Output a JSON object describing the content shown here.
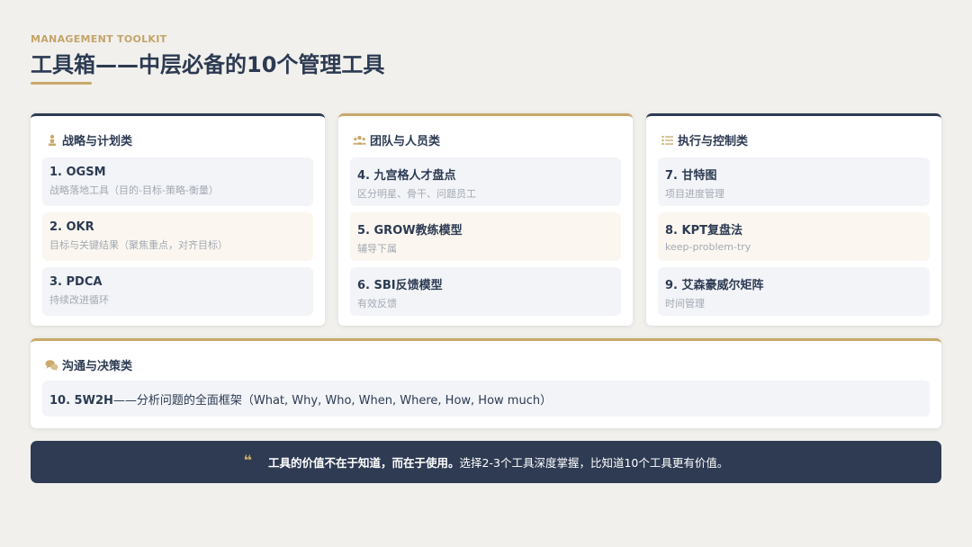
{
  "header": {
    "eyebrow": "MANAGEMENT TOOLKIT",
    "title": "工具箱——中层必备的10个管理工具"
  },
  "categories": [
    {
      "heading": "战略与计划类",
      "icon": "chess-icon",
      "items": [
        {
          "title": "1. OGSM",
          "subtitle": "战略落地工具（目的-目标-策略-衡量）"
        },
        {
          "title": "2. OKR",
          "subtitle": "目标与关键结果（聚焦重点，对齐目标）"
        },
        {
          "title": "3. PDCA",
          "subtitle": "持续改进循环"
        }
      ]
    },
    {
      "heading": "团队与人员类",
      "icon": "team-icon",
      "items": [
        {
          "title": "4. 九宫格人才盘点",
          "subtitle": "区分明星、骨干、问题员工"
        },
        {
          "title": "5. GROW教练模型",
          "subtitle": "辅导下属"
        },
        {
          "title": "6. SBI反馈模型",
          "subtitle": "有效反馈"
        }
      ]
    },
    {
      "heading": "执行与控制类",
      "icon": "list-icon",
      "items": [
        {
          "title": "7. 甘特图",
          "subtitle": "项目进度管理"
        },
        {
          "title": "8. KPT复盘法",
          "subtitle": "keep-problem-try"
        },
        {
          "title": "9. 艾森豪威尔矩阵",
          "subtitle": "时间管理"
        }
      ]
    }
  ],
  "communication": {
    "heading": "沟通与决策类",
    "icon": "chat-icon",
    "item_title": "10. 5W2H",
    "item_desc": "——分析问题的全面框架（What, Why, Who, When, Where, How, How much）"
  },
  "quote": {
    "emphasis": "工具的价值不在于知道，而在于使用。",
    "rest": "选择2-3个工具深度掌握，比知道10个工具更有价值。"
  },
  "colors": {
    "navy": "#2e3b53",
    "gold": "#c9a86a",
    "background": "#f1f0ec"
  }
}
